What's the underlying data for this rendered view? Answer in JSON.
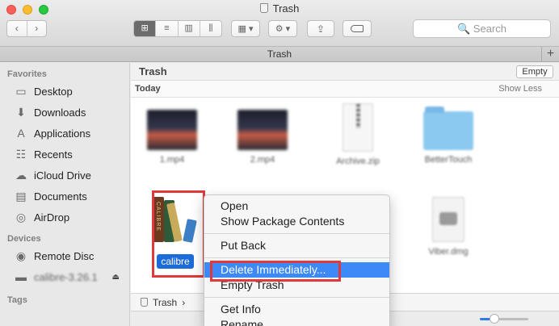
{
  "window": {
    "title": "Trash",
    "traffic_lights": [
      "close",
      "minimize",
      "zoom"
    ]
  },
  "toolbar": {
    "back_glyph": "‹",
    "forward_glyph": "›",
    "views": [
      "icon-view",
      "list-view",
      "column-view",
      "cover-flow-view"
    ],
    "view_glyphs": [
      "⊞",
      "≡",
      "▥",
      "⫼"
    ],
    "active_view": "icon-view",
    "arrange_glyph": "▦ ▾",
    "action_glyph": "⚙ ▾",
    "share_glyph": "⇪",
    "search_placeholder": "🔍 Search"
  },
  "tabbar": {
    "tab_label": "Trash",
    "add_glyph": "+"
  },
  "sidebar": {
    "sections": [
      {
        "title": "Favorites",
        "items": [
          {
            "label": "Desktop",
            "icon": "desktop-icon",
            "glyph": "▭"
          },
          {
            "label": "Downloads",
            "icon": "downloads-icon",
            "glyph": "⬇"
          },
          {
            "label": "Applications",
            "icon": "applications-icon",
            "glyph": "A"
          },
          {
            "label": "Recents",
            "icon": "recents-icon",
            "glyph": "☷"
          },
          {
            "label": "iCloud Drive",
            "icon": "cloud-icon",
            "glyph": "☁"
          },
          {
            "label": "Documents",
            "icon": "documents-icon",
            "glyph": "▤"
          },
          {
            "label": "AirDrop",
            "icon": "airdrop-icon",
            "glyph": "◎"
          }
        ]
      },
      {
        "title": "Devices",
        "items": [
          {
            "label": "Remote Disc",
            "icon": "disc-icon",
            "glyph": "◉"
          },
          {
            "label": "calibre-3.26.1",
            "icon": "drive-icon",
            "glyph": "▬",
            "eject": "⏏"
          }
        ]
      },
      {
        "title": "Tags",
        "items": []
      }
    ]
  },
  "main": {
    "path_title": "Trash",
    "empty_button": "Empty",
    "group_title": "Today",
    "show_less": "Show Less",
    "files": [
      {
        "name": "1.mp4",
        "kind": "video"
      },
      {
        "name": "2.mp4",
        "kind": "video"
      },
      {
        "name": "Archive.zip",
        "kind": "zip"
      },
      {
        "name": "BetterTouch",
        "kind": "folder"
      },
      {
        "name": "calibre",
        "kind": "app"
      },
      {
        "name": "Viber.dmg",
        "kind": "dmg"
      }
    ],
    "status_path": [
      "Trash",
      "›"
    ],
    "zoom_level": 0.3
  },
  "context_menu": {
    "items": [
      {
        "label": "Open",
        "group": 1
      },
      {
        "label": "Show Package Contents",
        "group": 1
      },
      {
        "label": "Put Back",
        "group": 2
      },
      {
        "label": "Delete Immediately...",
        "group": 3,
        "highlighted": true
      },
      {
        "label": "Empty Trash",
        "group": 3
      },
      {
        "label": "Get Info",
        "group": 4
      },
      {
        "label": "Rename",
        "group": 4
      }
    ]
  },
  "colors": {
    "highlight": "#3d8af7",
    "selection_label": "#1c6bd9",
    "annotation_red": "#e0393b",
    "folder_blue": "#8cc9f0"
  }
}
